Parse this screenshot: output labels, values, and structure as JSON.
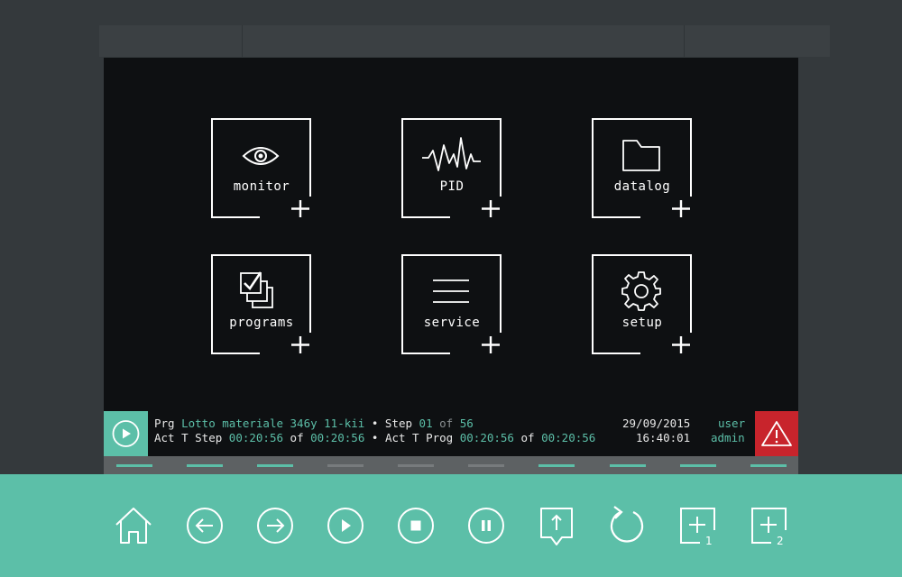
{
  "menu": {
    "tiles": [
      {
        "label": "monitor",
        "icon": "eye-icon"
      },
      {
        "label": "PID",
        "icon": "pulse-wave-icon"
      },
      {
        "label": "datalog",
        "icon": "folder-icon"
      },
      {
        "label": "programs",
        "icon": "stacked-checkbox-icon"
      },
      {
        "label": "service",
        "icon": "list-lines-icon"
      },
      {
        "label": "setup",
        "icon": "gear-icon"
      }
    ],
    "add_icon": "plus-icon"
  },
  "status": {
    "prg_label": "Prg",
    "program_name": "Lotto materiale 346y 11-kii",
    "bullet": "•",
    "step_label": "Step",
    "step_current": "01",
    "step_of": "of",
    "step_total": "56",
    "act_step_label": "Act T Step",
    "act_step_value": "00:20:56",
    "act_step_of": "of",
    "act_step_total": "00:20:56",
    "act_prog_label": "Act T Prog",
    "act_prog_value": "00:20:56",
    "act_prog_of": "of",
    "act_prog_total": "00:20:56",
    "date": "29/09/2015",
    "time": "16:40:01",
    "user_label": "user",
    "user_value": "admin",
    "run_icon": "play-circle-icon",
    "alert_icon": "warning-triangle-icon"
  },
  "page_indicators": [
    {
      "active": true
    },
    {
      "active": true
    },
    {
      "active": true
    },
    {
      "active": false
    },
    {
      "active": false
    },
    {
      "active": false
    },
    {
      "active": true
    },
    {
      "active": true
    },
    {
      "active": true
    },
    {
      "active": true
    }
  ],
  "toolbar": {
    "buttons": [
      "home-icon",
      "back-arrow-icon",
      "forward-arrow-icon",
      "play-icon",
      "stop-icon",
      "pause-icon",
      "upload-icon",
      "reset-icon",
      "add-1-icon",
      "add-2-icon"
    ],
    "add1_subscript": "1",
    "add2_subscript": "2"
  },
  "colors": {
    "accent": "#5cbfa8",
    "alert": "#c8242c",
    "screen_bg": "#0e1012",
    "inactive_bar": "#777b7d"
  }
}
